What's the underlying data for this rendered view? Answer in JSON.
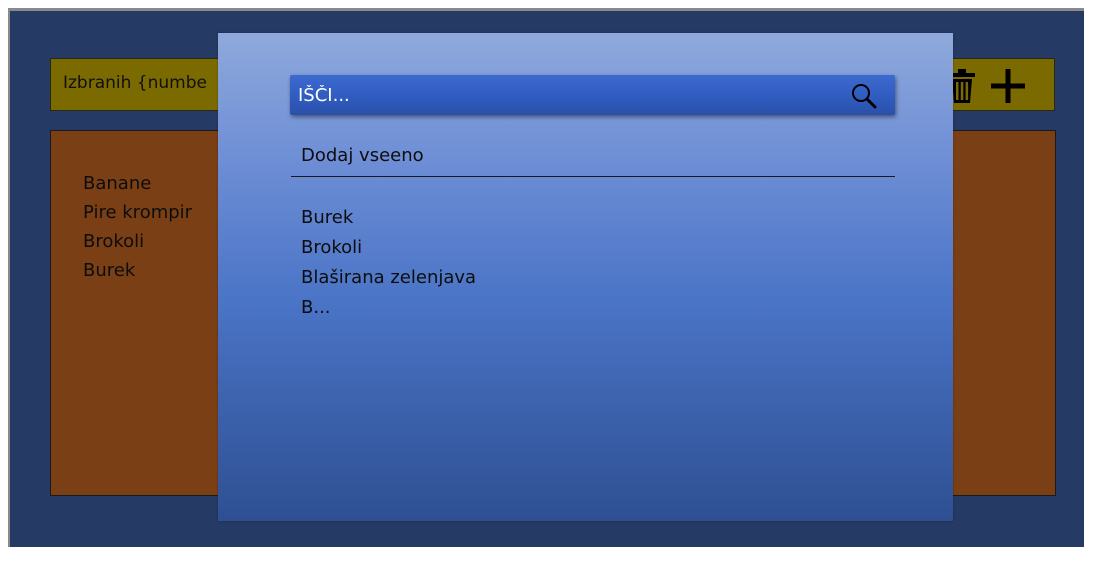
{
  "header": {
    "selected_label": "Izbranih {numbe"
  },
  "toolbar": {
    "delete_icon": "trash-icon",
    "add_icon": "plus-icon"
  },
  "selected_list": {
    "items": [
      "Banane",
      "Pire krompir",
      "Brokoli",
      "Burek"
    ]
  },
  "search": {
    "placeholder": "IŠČI...",
    "icon": "search-icon",
    "add_anyway_label": "Dodaj vseeno",
    "results": [
      "Burek",
      "Brokoli",
      "Blaširana zelenjava",
      "B..."
    ]
  },
  "colors": {
    "app_background": "#253a64",
    "header_bar": "#7a6a00",
    "list_panel": "#7b3f15",
    "dialog_top": "#8fa9db",
    "dialog_bottom": "#2e4f92",
    "search_box": "#2f5bbf"
  }
}
